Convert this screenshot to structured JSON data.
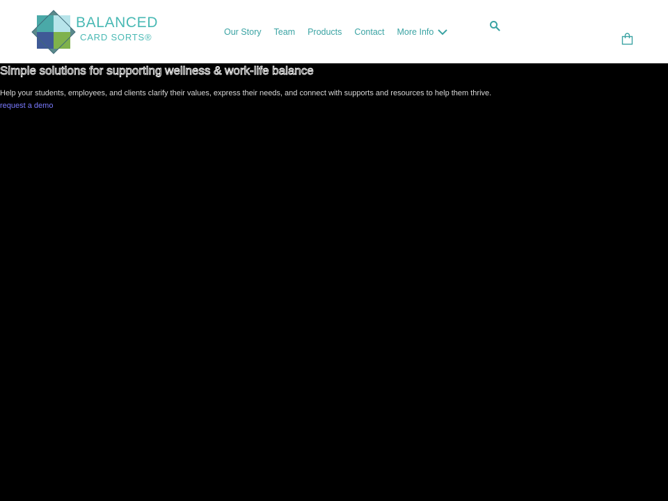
{
  "header": {
    "logo": {
      "line1": "BALANCED",
      "line2": "CARD SORTS®",
      "colors": {
        "teal": "#4aa9a8",
        "mint": "#b7e4ea",
        "navy": "#3f5a96",
        "green": "#7fb24c",
        "text": "#49b9b4"
      }
    },
    "nav": {
      "items": [
        {
          "label": "Our Story"
        },
        {
          "label": "Team"
        },
        {
          "label": "Products"
        },
        {
          "label": "Contact"
        }
      ],
      "more_label": "More Info",
      "more_icon": "chevron-down-icon"
    },
    "search_icon": "search-icon",
    "cart_icon": "shopping-bag-icon",
    "accent": "#3aa3a3"
  },
  "hero": {
    "title": "Simple solutions for supporting wellness & work-life balance",
    "subtitle": "Help your students, employees, and clients clarify their values, express their needs, and connect with supports and resources to help them thrive.",
    "cta": "request a demo"
  }
}
